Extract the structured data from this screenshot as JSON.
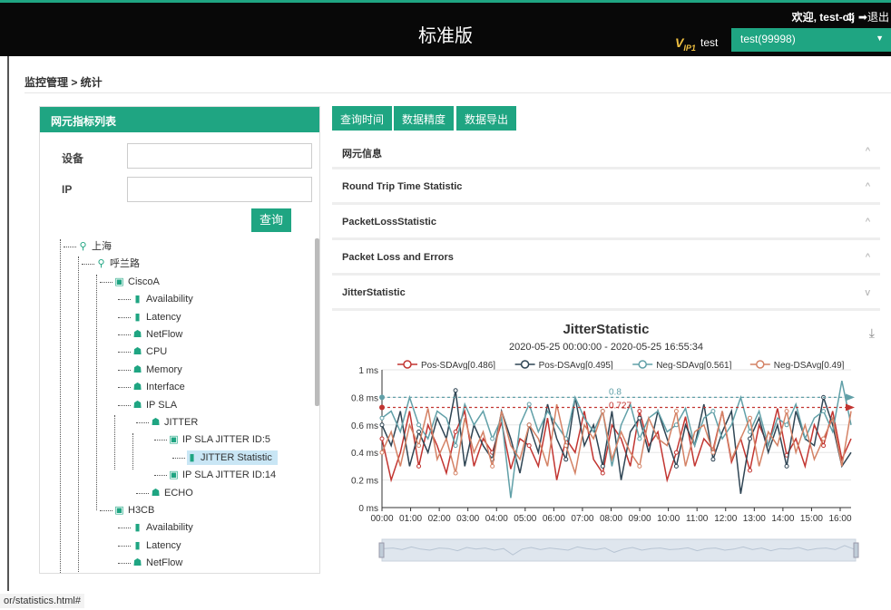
{
  "topbar": {
    "title": "标准版",
    "welcome": "欢迎, test-clj",
    "logout": "⚙ ➡退出",
    "logo": "V",
    "logo_sub": "IP1",
    "user": "test",
    "tenant": "test(99998)"
  },
  "breadcrumb": "监控管理 > 统计",
  "left_panel": {
    "title": "网元指标列表",
    "device_label": "设备",
    "ip_label": "IP",
    "query_button": "查询",
    "tree": [
      {
        "label": "上海",
        "icon": "location-icon"
      },
      {
        "label": "呼兰路",
        "icon": "location-icon"
      },
      {
        "label": "CiscoA",
        "icon": "device-icon"
      },
      {
        "label": "Availability",
        "icon": "bar-chart-icon"
      },
      {
        "label": "Latency",
        "icon": "bar-chart-icon"
      },
      {
        "label": "NetFlow",
        "icon": "house-icon"
      },
      {
        "label": "CPU",
        "icon": "house-icon"
      },
      {
        "label": "Memory",
        "icon": "house-icon"
      },
      {
        "label": "Interface",
        "icon": "house-icon"
      },
      {
        "label": "IP SLA",
        "icon": "house-icon"
      },
      {
        "label": "JITTER",
        "icon": "house-icon"
      },
      {
        "label": "IP SLA JITTER ID:5",
        "icon": "device-icon"
      },
      {
        "label": "JITTER Statistic",
        "icon": "bar-chart-icon"
      },
      {
        "label": "IP SLA JITTER ID:14",
        "icon": "device-icon"
      },
      {
        "label": "ECHO",
        "icon": "house-icon"
      },
      {
        "label": "H3CB",
        "icon": "device-icon"
      },
      {
        "label": "Availability",
        "icon": "bar-chart-icon"
      },
      {
        "label": "Latency",
        "icon": "bar-chart-icon"
      },
      {
        "label": "NetFlow",
        "icon": "house-icon"
      }
    ]
  },
  "toolbar": {
    "query_time": "查询时间",
    "precision": "数据精度",
    "export": "数据导出"
  },
  "accordion": [
    {
      "label": "网元信息",
      "chevron": "^"
    },
    {
      "label": "Round Trip Time Statistic",
      "chevron": "^"
    },
    {
      "label": "PacketLossStatistic",
      "chevron": "^"
    },
    {
      "label": "Packet Loss and Errors",
      "chevron": "^"
    },
    {
      "label": "JitterStatistic",
      "chevron": "v"
    }
  ],
  "status_url": "or/statistics.html#",
  "colors": {
    "accent": "#1fa582",
    "series": [
      "#c23531",
      "#2f4554",
      "#61a0a8",
      "#d48265"
    ]
  },
  "chart_data": {
    "type": "line",
    "title": "JitterStatistic",
    "subtitle": "2020-05-25 00:00:00 - 2020-05-25 16:55:34",
    "ylim": [
      0,
      1
    ],
    "y_ticks": [
      "0 ms",
      "0.2 ms",
      "0.4 ms",
      "0.6 ms",
      "0.8 ms",
      "1 ms"
    ],
    "x_ticks": [
      "00:00",
      "01:00",
      "02:00",
      "03:00",
      "04:00",
      "05:00",
      "06:00",
      "07:00",
      "08:00",
      "09:00",
      "10:00",
      "11:00",
      "12:00",
      "13:00",
      "14:00",
      "15:00",
      "16:00"
    ],
    "legend_position": "top",
    "grid": true,
    "markline_labels": [
      "0.8",
      "0.727"
    ],
    "series": [
      {
        "name": "Pos-SDAvg[0.486]",
        "values": [
          0.5,
          0.2,
          0.4,
          0.7,
          0.3,
          0.6,
          0.45,
          0.25,
          0.55,
          0.7,
          0.3,
          0.5,
          0.4,
          0.62,
          0.28,
          0.5,
          0.45,
          0.3,
          0.65,
          0.2,
          0.5,
          0.4,
          0.7,
          0.35,
          0.25,
          0.6,
          0.5,
          0.3,
          0.7,
          0.45,
          0.55,
          0.2,
          0.4,
          0.66,
          0.3,
          0.5,
          0.42,
          0.7,
          0.33,
          0.5,
          0.27,
          0.6,
          0.45,
          0.72,
          0.38,
          0.5,
          0.3,
          0.6,
          0.45,
          0.7,
          0.35,
          0.5
        ]
      },
      {
        "name": "Pos-DSAvg[0.495]",
        "values": [
          0.6,
          0.45,
          0.7,
          0.3,
          0.55,
          0.4,
          0.65,
          0.5,
          0.85,
          0.3,
          0.6,
          0.45,
          0.35,
          0.7,
          0.5,
          0.25,
          0.6,
          0.4,
          0.75,
          0.5,
          0.35,
          0.8,
          0.45,
          0.6,
          0.3,
          0.7,
          0.2,
          0.55,
          0.65,
          0.4,
          0.7,
          0.5,
          0.3,
          0.6,
          0.45,
          0.75,
          0.35,
          0.55,
          0.7,
          0.1,
          0.5,
          0.65,
          0.4,
          0.6,
          0.3,
          0.7,
          0.5,
          0.45,
          0.8,
          0.6,
          0.3,
          0.4
        ]
      },
      {
        "name": "Neg-SDAvg[0.561]",
        "values": [
          0.65,
          0.7,
          0.55,
          0.8,
          0.6,
          0.5,
          0.7,
          0.65,
          0.45,
          0.75,
          0.6,
          0.7,
          0.5,
          0.65,
          0.07,
          0.6,
          0.75,
          0.55,
          0.7,
          0.6,
          0.5,
          0.8,
          0.65,
          0.55,
          0.7,
          0.3,
          0.6,
          0.75,
          0.5,
          0.65,
          0.7,
          0.55,
          0.6,
          0.72,
          0.45,
          0.65,
          0.7,
          0.5,
          0.6,
          0.8,
          0.55,
          0.7,
          0.45,
          0.65,
          0.6,
          0.75,
          0.5,
          0.65,
          0.7,
          0.55,
          0.92,
          0.6
        ]
      },
      {
        "name": "Neg-DSAvg[0.49]",
        "values": [
          0.4,
          0.55,
          0.3,
          0.6,
          0.45,
          0.72,
          0.35,
          0.5,
          0.25,
          0.65,
          0.4,
          0.55,
          0.3,
          0.7,
          0.45,
          0.35,
          0.6,
          0.5,
          0.3,
          0.75,
          0.45,
          0.25,
          0.6,
          0.5,
          0.7,
          0.35,
          0.55,
          0.4,
          0.3,
          0.65,
          0.5,
          0.45,
          0.7,
          0.3,
          0.55,
          0.6,
          0.4,
          0.7,
          0.35,
          0.5,
          0.65,
          0.3,
          0.55,
          0.45,
          0.7,
          0.4,
          0.6,
          0.35,
          0.5,
          0.65,
          0.3,
          0.7
        ]
      }
    ]
  }
}
